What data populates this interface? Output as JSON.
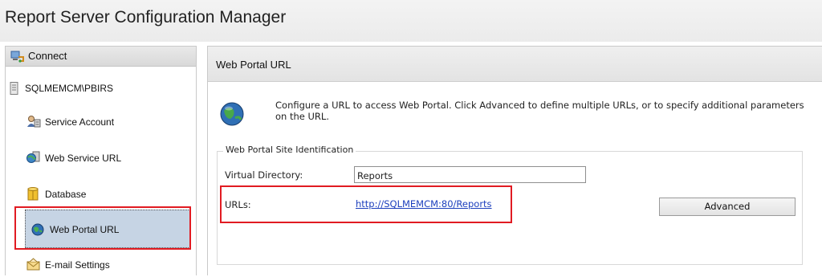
{
  "app": {
    "title": "Report Server Configuration Manager"
  },
  "sidebar": {
    "connect_label": "Connect",
    "server": "SQLMEMCM\\PBIRS",
    "items": [
      {
        "label": "Service Account",
        "icon": "service-account-icon"
      },
      {
        "label": "Web Service URL",
        "icon": "web-service-icon"
      },
      {
        "label": "Database",
        "icon": "database-icon"
      },
      {
        "label": "Web Portal URL",
        "icon": "globe-icon",
        "selected": true
      },
      {
        "label": "E-mail Settings",
        "icon": "email-icon"
      }
    ]
  },
  "main": {
    "title": "Web Portal URL",
    "description": "Configure a URL to access Web Portal.  Click Advanced to define multiple URLs, or to specify additional parameters on the URL.",
    "group_title": "Web Portal Site Identification",
    "virtual_directory_label": "Virtual Directory:",
    "virtual_directory_value": "Reports",
    "urls_label": "URLs:",
    "url": "http://SQLMEMCM:80/Reports",
    "advanced_button": "Advanced"
  },
  "colors": {
    "highlight": "#e11b22",
    "selected_bg": "#c6d4e4",
    "link": "#1c3fbd"
  }
}
